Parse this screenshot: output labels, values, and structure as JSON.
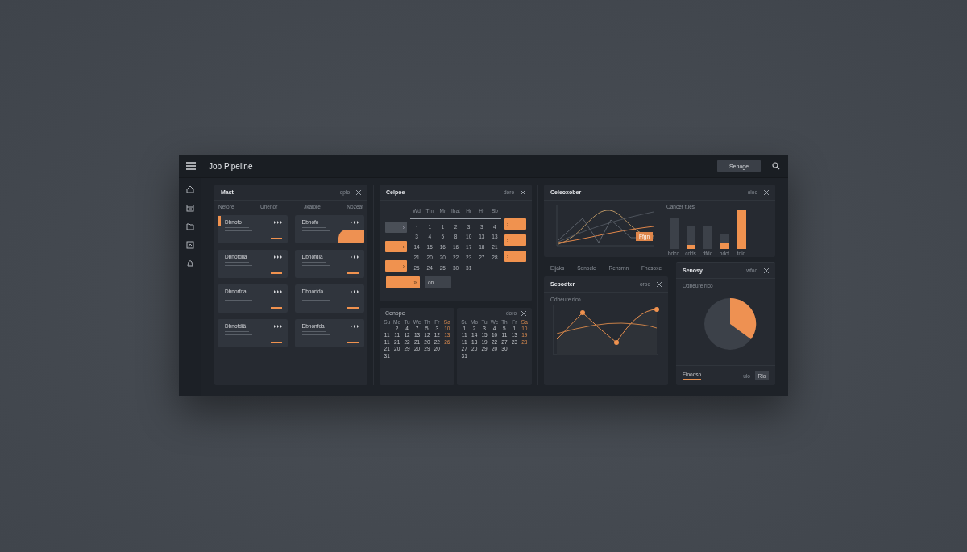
{
  "window": {
    "title": "Job Pipeline",
    "button": "Senoge"
  },
  "board": {
    "title": "Mast",
    "action": "oplo",
    "headings": [
      "Netoré",
      "Unenor",
      "Jkalore",
      "Nozeat"
    ],
    "cards": [
      {
        "title": "Dbnofo",
        "kind": "strip"
      },
      {
        "title": "Dbnofo",
        "kind": "corner"
      },
      {
        "title": "Dbnofdiia",
        "kind": "plain"
      },
      {
        "title": "Dbnofdia",
        "kind": "plain"
      },
      {
        "title": "Dbnorfda",
        "kind": "plain"
      },
      {
        "title": "Dbnorfda",
        "kind": "plain"
      },
      {
        "title": "Dbnofdiä",
        "kind": "plain"
      },
      {
        "title": "Dbnonfda",
        "kind": "plain"
      }
    ]
  },
  "scheduler": {
    "title": "Celpoe",
    "action": "doro",
    "weekdays": [
      "Wd",
      "Tm",
      "Mr",
      "Ihat",
      "Hr",
      "Hr",
      "Sb"
    ],
    "weeks": [
      {
        "days": [
          "·",
          "1",
          "1",
          "2",
          "3",
          "3",
          "4"
        ]
      },
      {
        "days": [
          "3",
          "4",
          "5",
          "8",
          "10",
          "13",
          "13"
        ]
      },
      {
        "days": [
          "14",
          "15",
          "16",
          "16",
          "17",
          "18",
          "21"
        ]
      },
      {
        "days": [
          "21",
          "20",
          "20",
          "22",
          "23",
          "27",
          "28"
        ]
      },
      {
        "days": [
          "25",
          "24",
          "25",
          "30",
          "31",
          "·"
        ]
      }
    ],
    "left_slots": [
      {
        "label": "›",
        "kind": "grey"
      },
      {
        "label": "›",
        "kind": "orange"
      },
      {
        "label": "›",
        "kind": "orange"
      }
    ],
    "right_slots": [
      {
        "label": "›"
      },
      {
        "label": "›"
      },
      {
        "label": "›"
      }
    ],
    "buttons": [
      {
        "label": "»",
        "kind": "primary"
      },
      {
        "label": "on",
        "kind": "secondary"
      }
    ]
  },
  "mini_calendars": [
    {
      "title": "Cenope",
      "weekdays": [
        "Su",
        "Mo",
        "Tu",
        "We",
        "Th",
        "Fr",
        "Sa"
      ],
      "weeks": [
        {
          "kind": "padded",
          "days": [
            "2",
            "4",
            "7",
            "5",
            "3",
            "10"
          ]
        },
        {
          "days": [
            "11",
            "11",
            "12",
            "13",
            "12",
            "12",
            "13"
          ]
        },
        {
          "days": [
            "11",
            "21",
            "22",
            "21",
            "20",
            "22",
            "26"
          ]
        },
        {
          "kind": "plain",
          "days": [
            "21",
            "20",
            "29",
            "20",
            "29",
            "20"
          ]
        },
        {
          "kind": "plain",
          "days": [
            "31"
          ]
        }
      ]
    },
    {
      "action": "doro",
      "weekdays": [
        "Su",
        "Mo",
        "Tu",
        "We",
        "Th",
        "Fr",
        "Sa"
      ],
      "weeks": [
        {
          "days": [
            "1",
            "2",
            "3",
            "4",
            "5",
            "1",
            "10"
          ]
        },
        {
          "days": [
            "11",
            "14",
            "15",
            "10",
            "11",
            "13",
            "19"
          ]
        },
        {
          "days": [
            "11",
            "18",
            "19",
            "22",
            "27",
            "23",
            "28"
          ]
        },
        {
          "kind": "plain",
          "days": [
            "27",
            "20",
            "29",
            "20",
            "30"
          ]
        },
        {
          "kind": "plain",
          "days": [
            "31"
          ]
        }
      ]
    }
  ],
  "overview": {
    "title": "Celeoxober",
    "action": "oloo",
    "tag": "Ffgn",
    "bars_title": "Cancer tues",
    "bar_labels": [
      "bdco",
      "cdds",
      "dfdd",
      "bdct",
      "tdid"
    ],
    "legend": [
      "Ejjaks",
      "Sdnocle",
      "Rensrnn",
      "Fhesoxe"
    ]
  },
  "trend": {
    "title": "Sepodter",
    "action": "oroo",
    "subtitle": "Odbeure rico"
  },
  "summary": {
    "title": "Senosy",
    "action": "wfoo",
    "subtitle": "Odbeure rico",
    "tab": "Fioodso",
    "note": "ulo",
    "button": "Rlo"
  }
}
